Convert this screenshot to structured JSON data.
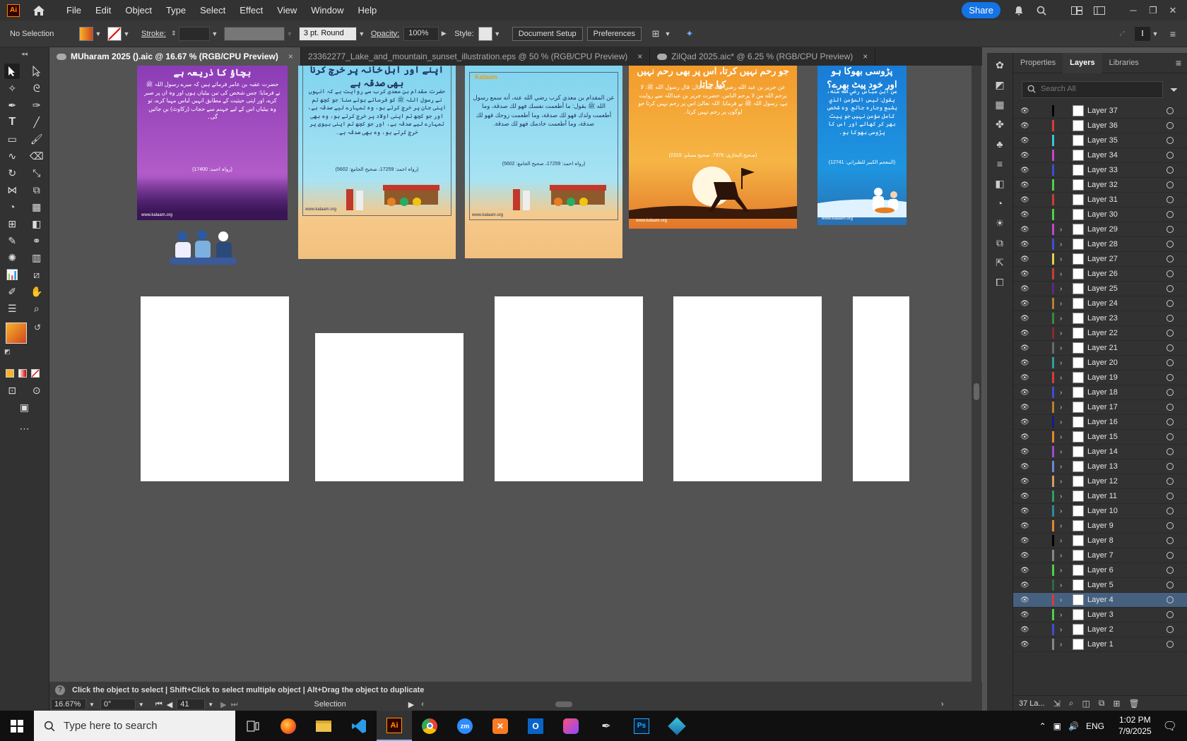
{
  "app": {
    "logo": "Ai"
  },
  "menu": [
    "File",
    "Edit",
    "Object",
    "Type",
    "Select",
    "Effect",
    "View",
    "Window",
    "Help"
  ],
  "menubar": {
    "share": "Share"
  },
  "control": {
    "selection": "No Selection",
    "stroke_label": "Stroke:",
    "brush": "3 pt. Round",
    "opacity_label": "Opacity:",
    "opacity": "100%",
    "style_label": "Style:",
    "document_setup": "Document Setup",
    "preferences": "Preferences"
  },
  "tabs": [
    {
      "label": "MUharam 2025 ().aic @ 16.67 % (RGB/CPU Preview)",
      "close": "×",
      "active": true,
      "cloud": true
    },
    {
      "label": "23362277_Lake_and_mountain_sunset_illustration.eps @ 50 % (RGB/CPU Preview)",
      "close": "×",
      "active": false,
      "cloud": false
    },
    {
      "label": "ZilQad 2025.aic* @ 6.25 % (RGB/CPU Preview)",
      "close": "×",
      "active": false,
      "cloud": true
    }
  ],
  "posters": [
    {
      "title": "بچاؤ کا ذریعہ ہے",
      "text": "حضرت عقبہ بن عامر فرماتے ہیں کہ میرے رسول اللہ ﷺ نے فرمایا: جس شخص کی تین بیٹیاں ہوں اور وہ ان پر صبر کرے، اور اپنی حیثیت کے مطابق انہیں لباس مہیا کرے، تو وہ بیٹیاں اس کے لیے جہنم سے حجاب (رکاوٹ) بن جائیں گی۔",
      "ref": "(رواہ احمد: 17400)",
      "footer": "www.kalaam.org"
    },
    {
      "title": "اپنے اور اہل خانہ پر خرچ کرنا بھی صدقہ ہے",
      "text": "حضرت مقدام بن معدی کرب سے روایت ہے کہ انہوں نے رسول اللہ ﷺ کو فرماتے ہوئے سنا: جو کچھ تم اپنی جان پر خرچ کرتے ہو، وہ تمہارے لیے صدقہ ہے، اور جو کچھ تم اپنی اولاد پر خرچ کرتے ہو، وہ بھی تمہارے لیے صدقہ ہے، اور جو کچھ تم اپنی بیوی پر خرچ کرتے ہو، وہ بھی صدقہ ہے۔",
      "ref": "(رواہ احمد: 17259، صحیح الجامع: 5602)",
      "footer": "www.kalaam.org"
    },
    {
      "title": "",
      "text": "عن المقدام بن معدي كرب رضي الله عنه، أنه سمع رسول الله ﷺ يقول: ما أطعمت نفسك فهو لك صدقة، وما أطعمت ولدك فهو لك صدقة، وما أطعمت زوجك فهو لك صدقة، وما أطعمت خادمك فهو لك صدقة.",
      "ref": "(رواہ احمد: 17259، صحیح الجامع: 5602)",
      "footer": "www.kalaam.org",
      "brand": "Kalaam"
    },
    {
      "title": "جو رحم نہیں کرتا، اس پر بھی رحم نہیں کیا جاتا",
      "text": "عن جرير بن عبد الله رضي الله عنه، قال: قال رسول الله ﷺ: لا يرحم الله من لا يرحم الناس. حضرت جریر بن عبداللہ سے روایت ہے، رسول اللہ ﷺ نے فرمایا: اللہ تعالیٰ اس پر رحم نہیں کرتا جو لوگوں پر رحم نہیں کرتا۔",
      "ref": "(صحیح البخاری: 7376، صحیح مسلم: 2319)",
      "footer": "www.kalaam.org"
    },
    {
      "title": "پڑوسی بھوکا ہو اور خود پیٹ بھرے؟",
      "text": "عن ابن عباس رضي الله عنه، يقول: ليس المؤمن الذي يشبع وجاره جائع. وہ شخص کامل مؤمن نہیں جو پیٹ بھر کر کھائے اور اس کا پڑوسی بھوکا ہو۔",
      "ref": "(المعجم الكبير للطبراني: 12741)",
      "footer": "www.kalaam.org"
    }
  ],
  "hint": {
    "icon": "?",
    "text": "Click the object to select  |  Shift+Click to select multiple object  |  Alt+Drag the object to duplicate"
  },
  "status": {
    "zoom": "16.67%",
    "rotation": "0°",
    "artboard": "41",
    "tool": "Selection"
  },
  "panel": {
    "tabs": [
      "Properties",
      "Layers",
      "Libraries"
    ],
    "active_tab": "Layers",
    "search_placeholder": "Search All",
    "footer_count": "37 La..."
  },
  "layers": [
    {
      "name": "Layer 37",
      "color": "#000000",
      "expandable": false,
      "selected": false
    },
    {
      "name": "Layer 36",
      "color": "#d83b3b",
      "expandable": false,
      "selected": false
    },
    {
      "name": "Layer 35",
      "color": "#35c7d9",
      "expandable": false,
      "selected": false
    },
    {
      "name": "Layer 34",
      "color": "#c246c9",
      "expandable": false,
      "selected": false
    },
    {
      "name": "Layer 33",
      "color": "#3c4fd6",
      "expandable": false,
      "selected": false
    },
    {
      "name": "Layer 32",
      "color": "#4ccf4c",
      "expandable": false,
      "selected": false
    },
    {
      "name": "Layer 31",
      "color": "#c83c3c",
      "expandable": false,
      "selected": false
    },
    {
      "name": "Layer 30",
      "color": "#4ccf4c",
      "expandable": false,
      "selected": false
    },
    {
      "name": "Layer 29",
      "color": "#c246c9",
      "expandable": true,
      "selected": false
    },
    {
      "name": "Layer 28",
      "color": "#3c4fd6",
      "expandable": true,
      "selected": false
    },
    {
      "name": "Layer 27",
      "color": "#e3d14a",
      "expandable": true,
      "selected": false
    },
    {
      "name": "Layer 26",
      "color": "#c83c3c",
      "expandable": true,
      "selected": false
    },
    {
      "name": "Layer 25",
      "color": "#5a2a8a",
      "expandable": true,
      "selected": false
    },
    {
      "name": "Layer 24",
      "color": "#b8802e",
      "expandable": true,
      "selected": false
    },
    {
      "name": "Layer 23",
      "color": "#3a8a3a",
      "expandable": true,
      "selected": false
    },
    {
      "name": "Layer 22",
      "color": "#8a2a2a",
      "expandable": true,
      "selected": false
    },
    {
      "name": "Layer 21",
      "color": "#6a6a6a",
      "expandable": true,
      "selected": false
    },
    {
      "name": "Layer 20",
      "color": "#2aa0a0",
      "expandable": true,
      "selected": false
    },
    {
      "name": "Layer 19",
      "color": "#d83b3b",
      "expandable": true,
      "selected": false
    },
    {
      "name": "Layer 18",
      "color": "#3c4fd6",
      "expandable": true,
      "selected": false
    },
    {
      "name": "Layer 17",
      "color": "#b8802e",
      "expandable": true,
      "selected": false
    },
    {
      "name": "Layer 16",
      "color": "#1a1a8a",
      "expandable": true,
      "selected": false
    },
    {
      "name": "Layer 15",
      "color": "#e08a2a",
      "expandable": true,
      "selected": false
    },
    {
      "name": "Layer 14",
      "color": "#9b4ccf",
      "expandable": true,
      "selected": false
    },
    {
      "name": "Layer 13",
      "color": "#6a8ad6",
      "expandable": true,
      "selected": false
    },
    {
      "name": "Layer 12",
      "color": "#d0a060",
      "expandable": true,
      "selected": false
    },
    {
      "name": "Layer 11",
      "color": "#2aa060",
      "expandable": true,
      "selected": false
    },
    {
      "name": "Layer 10",
      "color": "#2a8aa0",
      "expandable": true,
      "selected": false
    },
    {
      "name": "Layer 9",
      "color": "#e08a2a",
      "expandable": true,
      "selected": false
    },
    {
      "name": "Layer 8",
      "color": "#000000",
      "expandable": true,
      "selected": false
    },
    {
      "name": "Layer 7",
      "color": "#888888",
      "expandable": true,
      "selected": false
    },
    {
      "name": "Layer 6",
      "color": "#4ccf4c",
      "expandable": true,
      "selected": false
    },
    {
      "name": "Layer 5",
      "color": "#2a6a4a",
      "expandable": true,
      "selected": false
    },
    {
      "name": "Layer 4",
      "color": "#d83b3b",
      "expandable": true,
      "selected": true
    },
    {
      "name": "Layer 3",
      "color": "#4ccf4c",
      "expandable": true,
      "selected": false
    },
    {
      "name": "Layer 2",
      "color": "#3c4fd6",
      "expandable": true,
      "selected": false
    },
    {
      "name": "Layer 1",
      "color": "#888888",
      "expandable": true,
      "selected": false
    }
  ],
  "taskbar": {
    "search_placeholder": "Type here to search",
    "time": "1:02 PM",
    "date": "7/9/2025"
  },
  "colors": {
    "accent": "#1473e6",
    "selected_layer": "#46607f",
    "ai_orange": "#ff9a00"
  }
}
